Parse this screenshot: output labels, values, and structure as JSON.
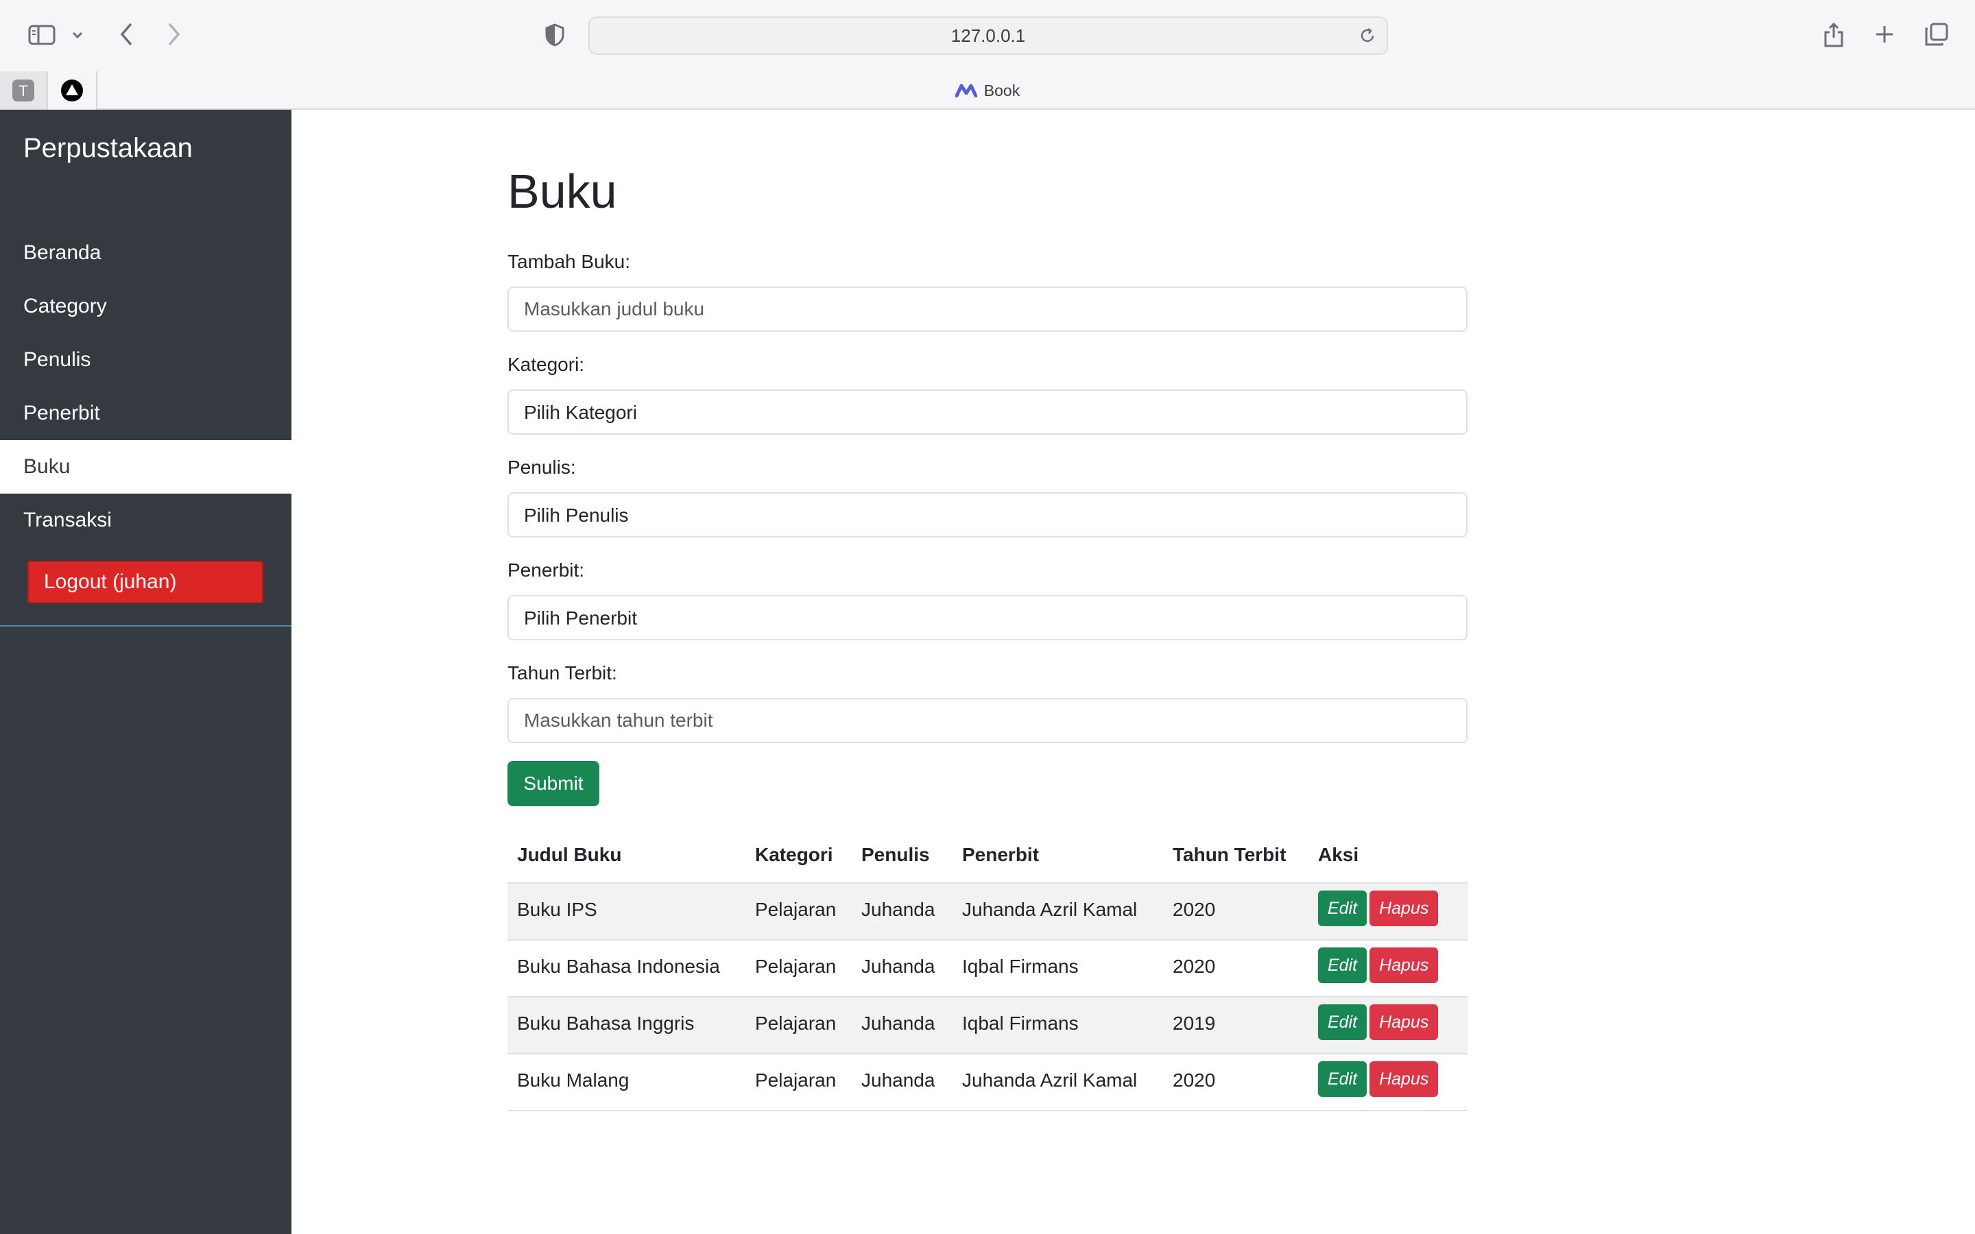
{
  "browser": {
    "url": "127.0.0.1",
    "tab_title": "Book",
    "pinned_tab_letter": "T"
  },
  "sidebar": {
    "brand": "Perpustakaan",
    "items": [
      {
        "label": "Beranda",
        "active": false
      },
      {
        "label": "Category",
        "active": false
      },
      {
        "label": "Penulis",
        "active": false
      },
      {
        "label": "Penerbit",
        "active": false
      },
      {
        "label": "Buku",
        "active": true
      },
      {
        "label": "Transaksi",
        "active": false
      }
    ],
    "logout_label": "Logout (juhan)",
    "colors": {
      "background": "#343a40",
      "logout": "#dc2626"
    }
  },
  "main": {
    "title": "Buku",
    "form": {
      "judul_label": "Tambah Buku:",
      "judul_placeholder": "Masukkan judul buku",
      "kategori_label": "Kategori:",
      "kategori_value": "Pilih Kategori",
      "penulis_label": "Penulis:",
      "penulis_value": "Pilih Penulis",
      "penerbit_label": "Penerbit:",
      "penerbit_value": "Pilih Penerbit",
      "tahun_label": "Tahun Terbit:",
      "tahun_placeholder": "Masukkan tahun terbit",
      "submit_label": "Submit"
    },
    "table": {
      "headers": [
        "Judul Buku",
        "Kategori",
        "Penulis",
        "Penerbit",
        "Tahun Terbit",
        "Aksi"
      ],
      "rows": [
        {
          "judul": "Buku IPS",
          "kategori": "Pelajaran",
          "penulis": "Juhanda",
          "penerbit": "Juhanda Azril Kamal",
          "tahun": "2020"
        },
        {
          "judul": "Buku Bahasa Indonesia",
          "kategori": "Pelajaran",
          "penulis": "Juhanda",
          "penerbit": "Iqbal Firmans",
          "tahun": "2020"
        },
        {
          "judul": "Buku Bahasa Inggris",
          "kategori": "Pelajaran",
          "penulis": "Juhanda",
          "penerbit": "Iqbal Firmans",
          "tahun": "2019"
        },
        {
          "judul": "Buku Malang",
          "kategori": "Pelajaran",
          "penulis": "Juhanda",
          "penerbit": "Juhanda Azril Kamal",
          "tahun": "2020"
        }
      ],
      "edit_label": "Edit",
      "hapus_label": "Hapus"
    },
    "colors": {
      "success": "#198754",
      "danger": "#dc3545"
    }
  }
}
